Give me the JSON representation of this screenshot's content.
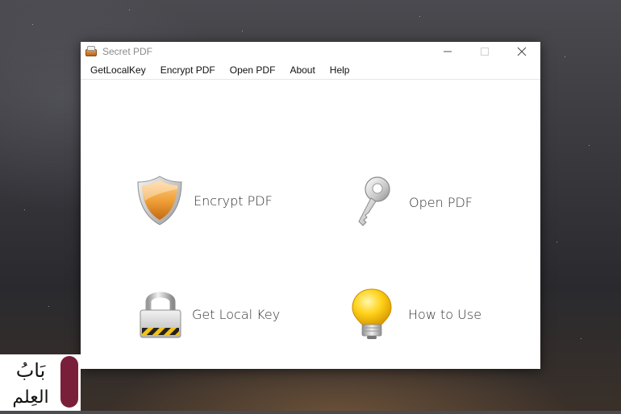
{
  "window": {
    "title": "Secret PDF",
    "controls": {
      "minimize": "—",
      "maximize": "☐",
      "close": "✕"
    }
  },
  "menu": [
    "GetLocalKey",
    "Encrypt PDF",
    "Open PDF",
    "About",
    "Help"
  ],
  "tiles": [
    {
      "label": "Encrypt PDF",
      "icon": "shield-icon"
    },
    {
      "label": "Open PDF",
      "icon": "key-icon"
    },
    {
      "label": "Get Local Key",
      "icon": "padlock-icon"
    },
    {
      "label": "How to Use",
      "icon": "lightbulb-icon"
    }
  ],
  "watermark": {
    "text_line1": "بَابُ",
    "text_line2": "العِلم"
  },
  "colors": {
    "shield": "#f0a13a",
    "bulb": "#ffd21a",
    "window_bg": "#ffffff"
  }
}
